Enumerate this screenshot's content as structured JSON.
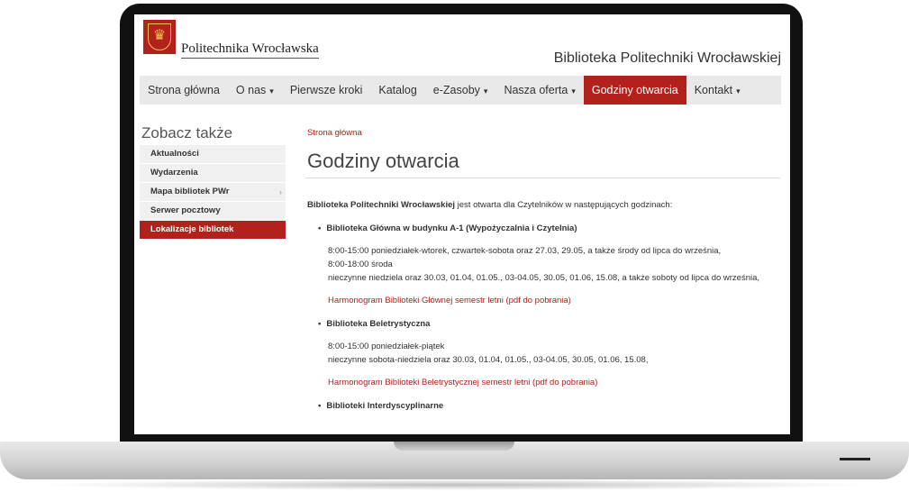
{
  "header": {
    "university": "Politechnika Wrocławska",
    "library": "Biblioteka Politechniki Wrocławskiej"
  },
  "nav": {
    "items": [
      {
        "label": "Strona główna"
      },
      {
        "label": "O nas",
        "caret": "▾"
      },
      {
        "label": "Pierwsze kroki"
      },
      {
        "label": "Katalog"
      },
      {
        "label": "e-Zasoby",
        "caret": "▾"
      },
      {
        "label": "Nasza oferta",
        "caret": "▾"
      },
      {
        "label": "Godziny otwarcia"
      },
      {
        "label": "Kontakt",
        "caret": "▾"
      }
    ],
    "active_index": 6
  },
  "sidebar": {
    "heading": "Zobacz także",
    "items": [
      {
        "label": "Aktualności"
      },
      {
        "label": "Wydarzenia"
      },
      {
        "label": "Mapa bibliotek PWr",
        "arrow": "›"
      },
      {
        "label": "Serwer pocztowy"
      },
      {
        "label": "Lokalizacje bibliotek"
      }
    ]
  },
  "main": {
    "breadcrumb": "Strona główna",
    "title": "Godziny otwarcia",
    "intro_bold": "Biblioteka Politechniki Wrocławskiej",
    "intro_rest": " jest otwarta dla Czytelników w następujących godzinach:",
    "sections": [
      {
        "heading": "Biblioteka Główna w budynku A-1 (Wypożyczalnia i Czytelnia)",
        "lines": [
          "8:00-15:00 poniedziałek-wtorek, czwartek-sobota oraz 27.03, 29.05, a także środy od lipca do września,",
          "8:00-18:00 środa",
          "nieczynne  niedziela oraz 30.03, 01.04, 01.05., 03-04.05, 30.05, 01.06, 15.08, a także soboty od lipca do września,"
        ],
        "link": "Harmonogram Biblioteki Głównej semestr letni (pdf do pobrania)"
      },
      {
        "heading": "Biblioteka Beletrystyczna",
        "lines": [
          "8:00-15:00 poniedziałek-piątek",
          "nieczynne  sobota-niedziela oraz 30.03, 01.04, 01.05., 03-04.05, 30.05, 01.06, 15.08,"
        ],
        "link": "Harmonogram Biblioteki Beletrystycznej semestr letni (pdf do pobrania)"
      },
      {
        "heading": "Biblioteki Interdyscyplinarne"
      }
    ]
  },
  "colors": {
    "accent": "#b2211b",
    "nav_bg": "#e9e9e9",
    "sidebar_bg": "#f0f0f0"
  }
}
